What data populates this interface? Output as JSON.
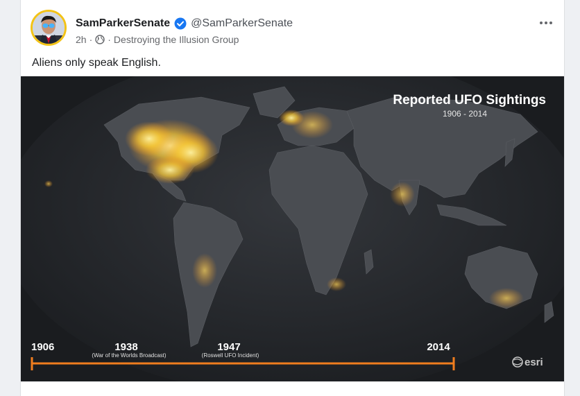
{
  "post": {
    "author_name": "SamParkerSenate",
    "author_handle": "@SamParkerSenate",
    "time": "2h",
    "separator": "·",
    "group": "Destroying the Illusion Group",
    "text": "Aliens only speak English.",
    "more_label": "•••",
    "verified_color": "#1877f2",
    "avatar_ring_color": "#f3c316"
  },
  "image": {
    "title": "Reported UFO Sightings",
    "subtitle": "1906 - 2014",
    "timeline": {
      "color": "#f07d1e",
      "labels": [
        {
          "year": "1906",
          "note": ""
        },
        {
          "year": "1938",
          "note": "(War of the Worlds Broadcast)"
        },
        {
          "year": "1947",
          "note": "(Roswell UFO Incident)"
        },
        {
          "year": "2014",
          "note": ""
        }
      ]
    },
    "logo_text": "esri",
    "hotspot_color": "#ffcc33"
  }
}
